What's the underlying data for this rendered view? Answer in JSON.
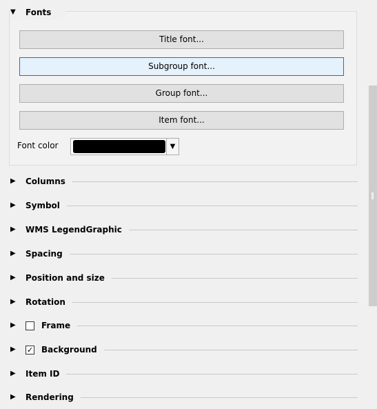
{
  "fonts_section": {
    "title": "Fonts",
    "buttons": {
      "title_font": "Title font...",
      "subgroup_font": "Subgroup font...",
      "group_font": "Group font...",
      "item_font": "Item font..."
    },
    "font_color_label": "Font color",
    "font_color_value": "#000000"
  },
  "sections": {
    "columns": "Columns",
    "symbol": "Symbol",
    "wms": "WMS LegendGraphic",
    "spacing": "Spacing",
    "position": "Position and size",
    "rotation": "Rotation",
    "frame": "Frame",
    "background": "Background",
    "item_id": "Item ID",
    "rendering": "Rendering"
  },
  "checkbox_states": {
    "frame": false,
    "background": true
  },
  "icons": {
    "expanded": "triangle-down-icon",
    "collapsed": "triangle-right-icon",
    "dropdown": "chevron-down-icon"
  },
  "colors": {
    "button_hover_bg": "#e5f1fb",
    "button_hover_border": "#0078d7"
  }
}
